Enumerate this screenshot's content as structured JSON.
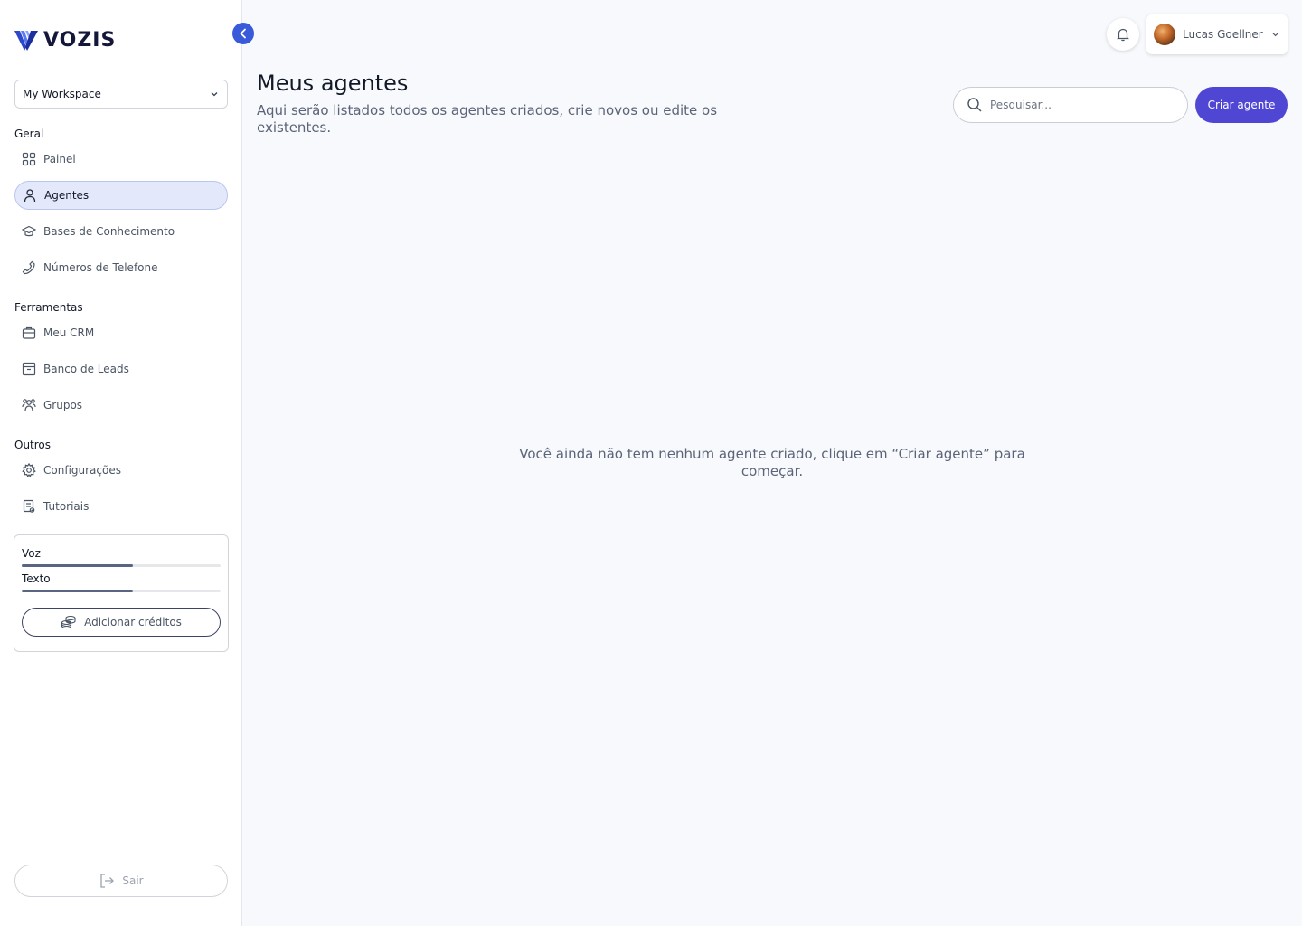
{
  "brand": {
    "name": "VOZIS",
    "accent": "#3a5bd9",
    "primary": "#5046d4"
  },
  "sidebar": {
    "workspace": "My Workspace",
    "sections": {
      "geral": "Geral",
      "ferramentas": "Ferramentas",
      "outros": "Outros"
    },
    "items": [
      {
        "label": "Painel",
        "icon": "grid-icon",
        "active": false
      },
      {
        "label": "Agentes",
        "icon": "user-icon",
        "active": true
      },
      {
        "label": "Bases de Conhecimento",
        "icon": "graduation-cap-icon",
        "active": false
      },
      {
        "label": "Números de Telefone",
        "icon": "phone-icon",
        "active": false
      },
      {
        "label": "Meu CRM",
        "icon": "briefcase-icon",
        "active": false
      },
      {
        "label": "Banco de Leads",
        "icon": "archive-icon",
        "active": false
      },
      {
        "label": "Grupos",
        "icon": "users-icon",
        "active": false
      },
      {
        "label": "Configurações",
        "icon": "gear-icon",
        "active": false
      },
      {
        "label": "Tutoriais",
        "icon": "document-icon",
        "active": false
      }
    ],
    "credits": {
      "voice_label": "Voz",
      "voice_fraction": 0.56,
      "text_label": "Texto",
      "text_fraction": 0.56,
      "add_label": "Adicionar créditos"
    },
    "logout_label": "Sair"
  },
  "header": {
    "user_name": "Lucas Goellner"
  },
  "main": {
    "title": "Meus agentes",
    "subtitle": "Aqui serão listados todos os agentes criados, crie novos ou edite os existentes.",
    "search_placeholder": "Pesquisar...",
    "create_label": "Criar agente",
    "empty_message": "Você ainda não tem nenhum agente criado, clique em “Criar agente” para começar."
  }
}
